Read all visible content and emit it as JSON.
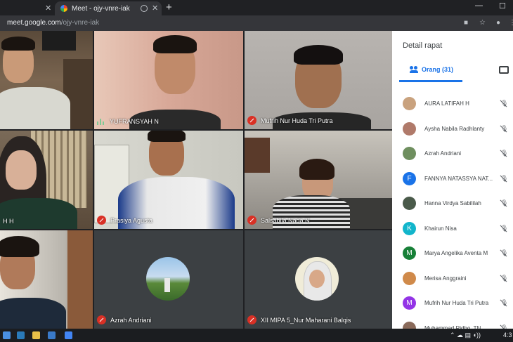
{
  "browser": {
    "tabs": [
      {
        "label": ""
      },
      {
        "label": "Meet - ojy-vnre-iak"
      }
    ],
    "url_host": "meet.google.com",
    "url_path": "/ojy-vnre-iak",
    "icons": [
      "close-icon",
      "record-icon",
      "new-tab-icon",
      "minimize-icon",
      "maximize-icon",
      "camera-icon",
      "star-icon",
      "profile-icon",
      "menu-icon"
    ]
  },
  "tiles": [
    {
      "name": ""
    },
    {
      "name": "YUFRANSYAH N"
    },
    {
      "name": "Mufrih Nur Huda Tri Putra"
    },
    {
      "name": "H H"
    },
    {
      "name": "Prasiya Agusta"
    },
    {
      "name": "Salsabila Nada N"
    },
    {
      "name": ""
    },
    {
      "name": "Azrah Andriani"
    },
    {
      "name": "XII MIPA 5_Nur Maharani Balqis"
    }
  ],
  "panel": {
    "title": "Detail rapat",
    "people_tab": "Orang (31)",
    "participants": [
      {
        "name": "AURA LATIFAH H",
        "initial": "",
        "color": "#c9a27e"
      },
      {
        "name": "Aysha Nabila Radhlanty",
        "initial": "",
        "color": "#b07a6a"
      },
      {
        "name": "Azrah Andriani",
        "initial": "",
        "color": "#6f8f5f"
      },
      {
        "name": "FANNYA NATASSYA NAT...",
        "initial": "F",
        "color": "#1a73e8"
      },
      {
        "name": "Hanna Virdya Sabililah",
        "initial": "",
        "color": "#4a5a4a"
      },
      {
        "name": "Khairun Nisa",
        "initial": "K",
        "color": "#12b5cb"
      },
      {
        "name": "Marya Angelika Aventa M",
        "initial": "M",
        "color": "#188038"
      },
      {
        "name": "Merisa Anggraini",
        "initial": "",
        "color": "#d08a4a"
      },
      {
        "name": "Mufrih Nur Huda Tri Putra",
        "initial": "M",
        "color": "#9334e6"
      },
      {
        "name": "Muhammad Ridho, TN",
        "initial": "",
        "color": "#8a6a5a"
      }
    ]
  },
  "taskbar": {
    "clock": "4:3"
  }
}
